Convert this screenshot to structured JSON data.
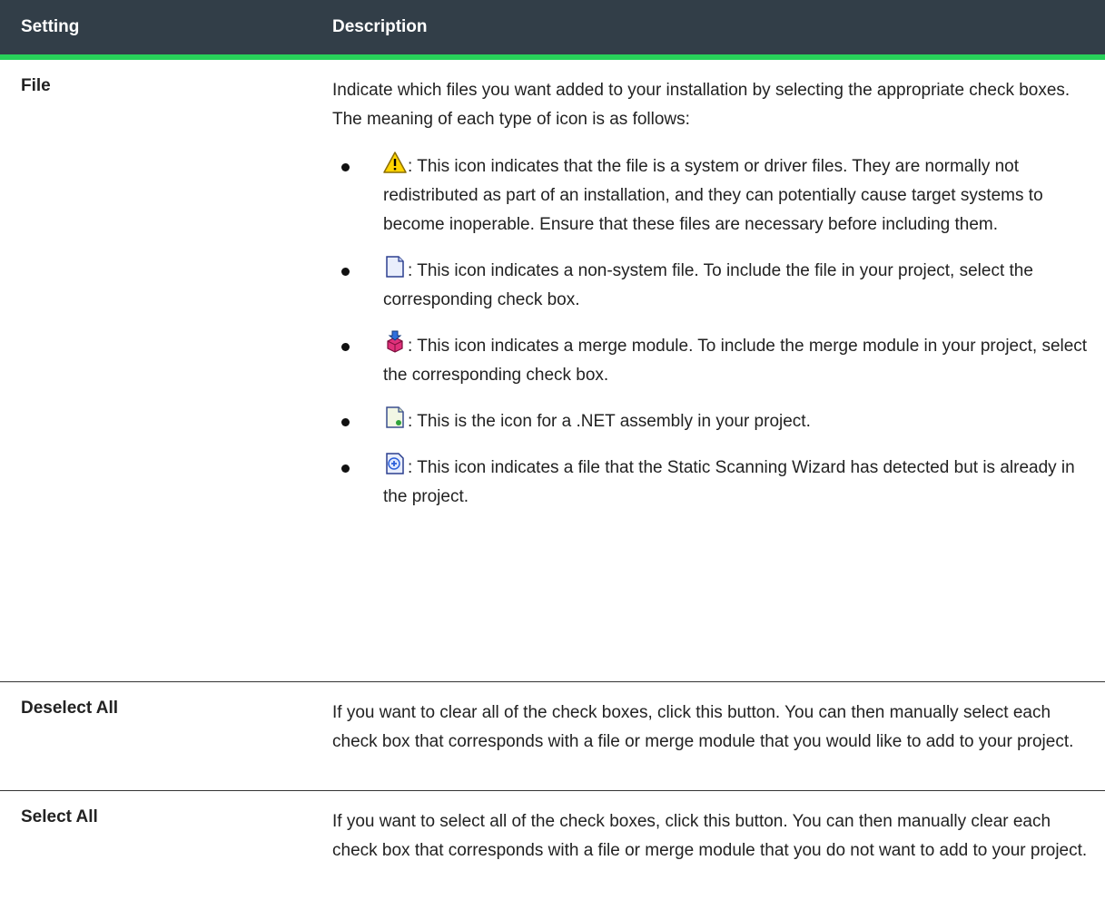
{
  "table": {
    "header": {
      "setting": "Setting",
      "description": "Description"
    },
    "rows": [
      {
        "setting": "File",
        "intro": "Indicate which files you want added to your installation by selecting the appropriate check boxes. The meaning of each type of icon is as follows:",
        "items": [
          {
            "icon": "warning-icon",
            "text": ": This icon indicates that the file is a system or driver files. They are normally not redistributed as part of an installation, and they can potentially cause target systems to become inoperable. Ensure that these files are necessary before including them."
          },
          {
            "icon": "file-icon",
            "text": ": This icon indicates a non-system file. To include the file in your project, select the corresponding check box."
          },
          {
            "icon": "merge-module-icon",
            "text": ": This icon indicates a merge module. To include the merge module in your project, select the corresponding check box."
          },
          {
            "icon": "net-assembly-icon",
            "text": ": This is the icon for a .NET assembly in your project."
          },
          {
            "icon": "detected-file-icon",
            "text": ": This icon indicates a file that the Static Scanning Wizard has detected but is already in the project."
          }
        ]
      },
      {
        "setting": "Deselect All",
        "description": "If you want to clear all of the check boxes, click this button. You can then manually select each check box that corresponds with a file or merge module that you would like to add to your project."
      },
      {
        "setting": "Select All",
        "description": "If you want to select all of the check boxes, click this button. You can then manually clear each check box that corresponds with a file or merge module that you do not want to add to your project."
      }
    ]
  },
  "colors": {
    "header_bg": "#323e48",
    "header_accent": "#28d15a",
    "text": "#222222"
  }
}
